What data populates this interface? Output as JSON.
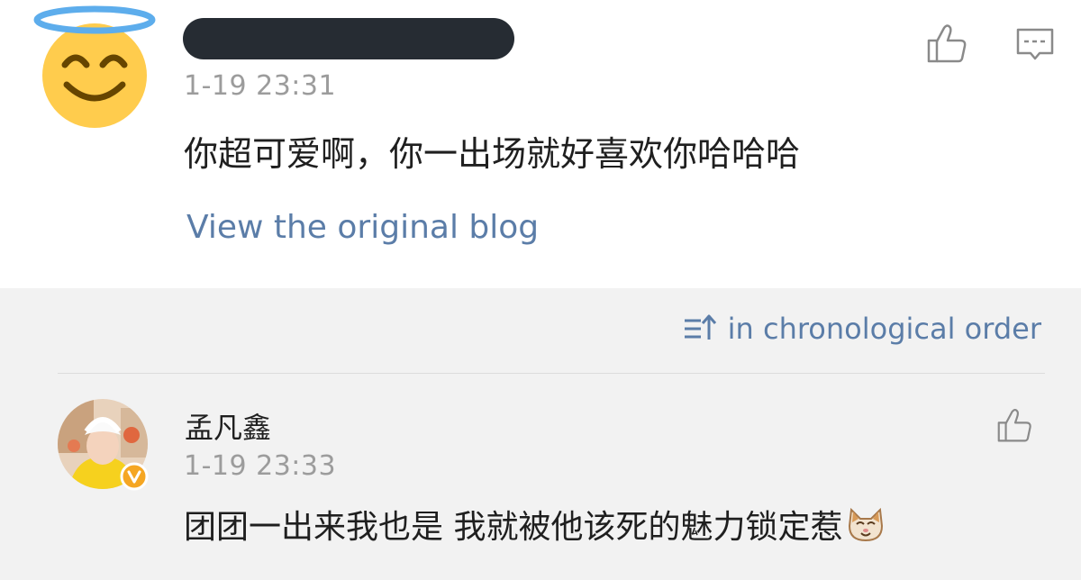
{
  "main_comment": {
    "timestamp": "1-19 23:31",
    "text": "你超可爱啊，你一出场就好喜欢你哈哈哈",
    "link_label": "View the original blog"
  },
  "sort": {
    "label": "in chronological order"
  },
  "reply": {
    "author": "孟凡鑫",
    "timestamp": "1-19 23:33",
    "text": "团团一出来我也是 我就被他该死的魅力锁定惹"
  },
  "icons": {
    "main_avatar": "smiling-face-with-halo-icon",
    "like": "thumbs-up-icon",
    "comment": "comment-icon",
    "sort": "sort-icon",
    "verified": "verified-badge-icon",
    "cat_emoji": "cat-face-emoji-icon"
  },
  "colors": {
    "link": "#5b7da8",
    "timestamp": "#9c9c9c",
    "reply_background": "#f2f2f2",
    "verified": "#f5a623"
  }
}
